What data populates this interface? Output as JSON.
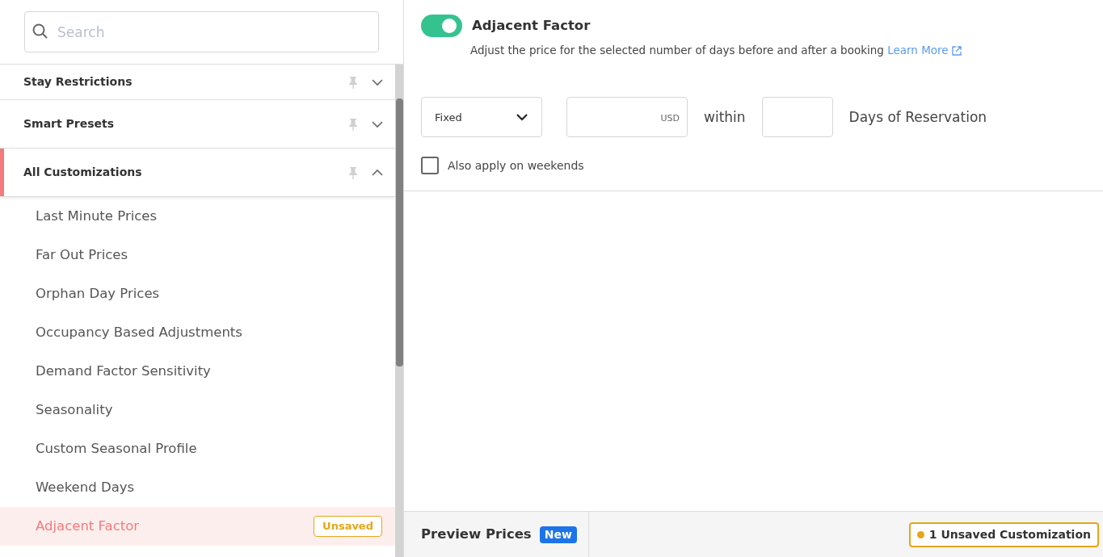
{
  "search": {
    "placeholder": "Search"
  },
  "sections": [
    {
      "title": "Stay Restrictions",
      "expanded": false,
      "active": false
    },
    {
      "title": "Smart Presets",
      "expanded": false,
      "active": false
    },
    {
      "title": "All Customizations",
      "expanded": true,
      "active": true,
      "children": [
        {
          "label": "Last Minute Prices",
          "selected": false
        },
        {
          "label": "Far Out Prices",
          "selected": false
        },
        {
          "label": "Orphan Day Prices",
          "selected": false
        },
        {
          "label": "Occupancy Based Adjustments",
          "selected": false
        },
        {
          "label": "Demand Factor Sensitivity",
          "selected": false
        },
        {
          "label": "Seasonality",
          "selected": false
        },
        {
          "label": "Custom Seasonal Profile",
          "selected": false
        },
        {
          "label": "Weekend Days",
          "selected": false
        },
        {
          "label": "Adjacent Factor",
          "selected": true,
          "badge": "Unsaved"
        }
      ]
    }
  ],
  "panel": {
    "on": true,
    "title": "Adjacent Factor",
    "description": "Adjust the price for the selected number of days before and after a booking",
    "link": "Learn More",
    "mode": "Fixed",
    "amount_unit": "USD",
    "within": "within",
    "days_label": "Days of Reservation",
    "weekends": {
      "label": "Also apply on weekends",
      "checked": false
    }
  },
  "footer": {
    "preview": "Preview Prices",
    "new_badge": "New",
    "unsaved": "1 Unsaved Customization"
  }
}
